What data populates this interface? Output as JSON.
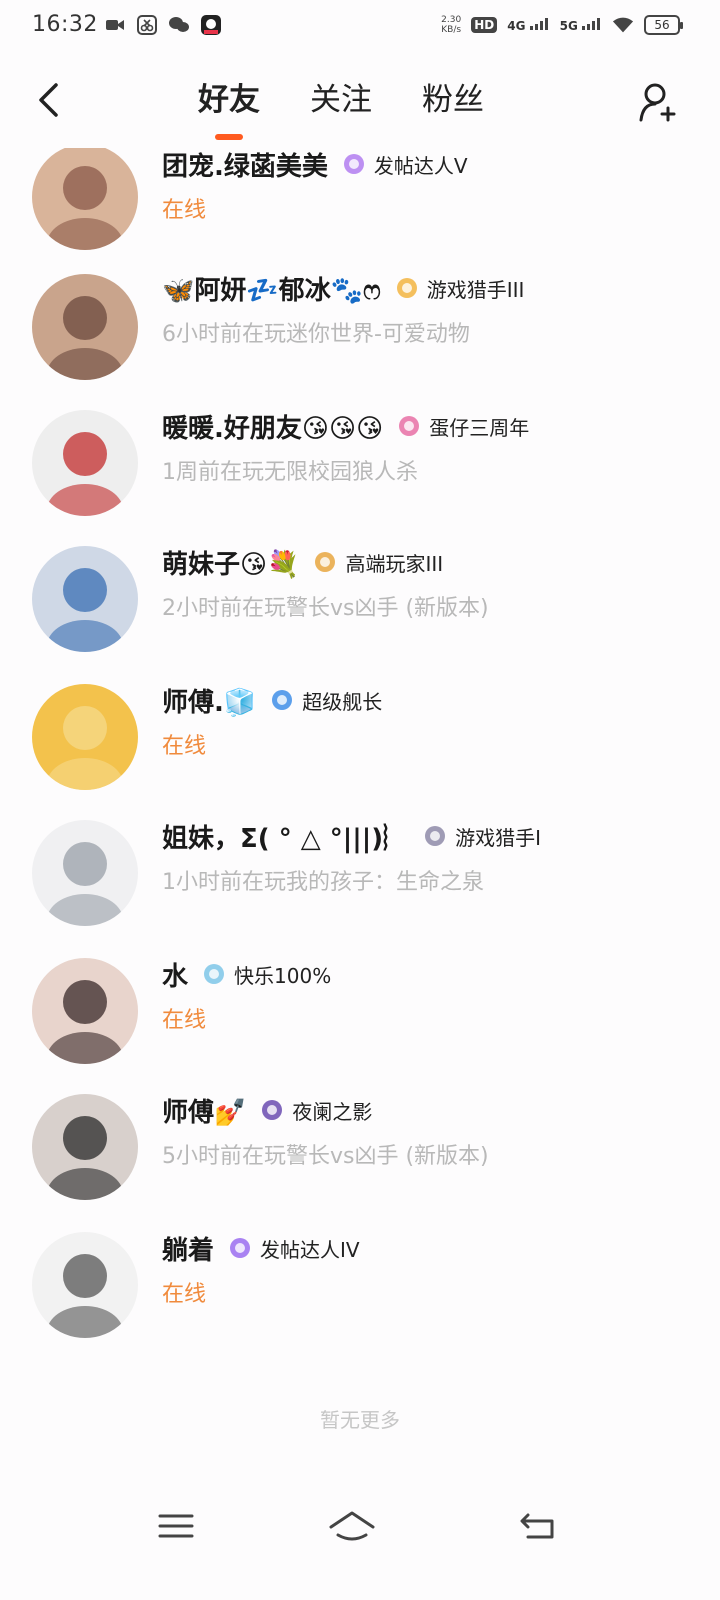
{
  "status_bar": {
    "time": "16:32",
    "net_speed_value": "2.30",
    "net_speed_unit": "KB/s",
    "hd_tag": "HD",
    "sim1": "4G",
    "sim2": "5G",
    "battery": "56"
  },
  "header": {
    "tabs": [
      {
        "label": "好友",
        "active": true
      },
      {
        "label": "关注",
        "active": false
      },
      {
        "label": "粉丝",
        "active": false
      }
    ]
  },
  "friends": [
    {
      "name": "团宠.绿菡美美",
      "badge": "发帖达人V",
      "badge_color": "#b27cf0",
      "status": "在线",
      "online": true,
      "avatar_colors": [
        "#8a5a4a",
        "#d9b49a"
      ]
    },
    {
      "name": "🦋阿妍💤郁冰🐾ෆ",
      "badge": "游戏猎手III",
      "badge_color": "#f2b441",
      "status": "6小时前在玩迷你世界-可爱动物",
      "online": false,
      "avatar_colors": [
        "#6b4a3e",
        "#c9a48c"
      ]
    },
    {
      "name": "暖暖.好朋友😘😘😘",
      "badge": "蛋仔三周年",
      "badge_color": "#e86ea5",
      "status": "1周前在玩无限校园狼人杀",
      "online": false,
      "avatar_colors": [
        "#c22c2c",
        "#eeeeee"
      ]
    },
    {
      "name": "萌妹子😘💐",
      "badge": "高端玩家III",
      "badge_color": "#e8a640",
      "status": "2小时前在玩警长vs凶手 (新版本)",
      "online": false,
      "avatar_colors": [
        "#3a6fb3",
        "#cfd8e6"
      ]
    },
    {
      "name": "师傅.🧊",
      "badge": "超级舰长",
      "badge_color": "#3f8ee8",
      "status": "在线",
      "online": true,
      "avatar_colors": [
        "#f6d98a",
        "#f3c24c"
      ]
    },
    {
      "name": "姐妹，Σ( ° △ °|||)︴",
      "badge": "游戏猎手I",
      "badge_color": "#8e8aa8",
      "status": "1小时前在玩我的孩子：生命之泉",
      "online": false,
      "avatar_colors": [
        "#9aa0a8",
        "#f0f0f2"
      ]
    },
    {
      "name": "水",
      "badge": "快乐100%",
      "badge_color": "#7ec6e8",
      "status": "在线",
      "online": true,
      "avatar_colors": [
        "#3a2a2a",
        "#e8d4cc"
      ]
    },
    {
      "name": "师傅💅",
      "badge": "夜阑之影",
      "badge_color": "#6a4bb0",
      "status": "5小时前在玩警长vs凶手 (新版本)",
      "online": false,
      "avatar_colors": [
        "#2a2a2a",
        "#d8d0cc"
      ]
    },
    {
      "name": "躺着",
      "badge": "发帖达人IV",
      "badge_color": "#9a6cf0",
      "status": "在线",
      "online": true,
      "avatar_colors": [
        "#555555",
        "#f2f2f2"
      ]
    }
  ],
  "footer": {
    "no_more_text": "暂无更多"
  },
  "colors": {
    "accent": "#ff5a1f",
    "online_text": "#f08a3c",
    "offline_text": "#b8b8b8"
  }
}
